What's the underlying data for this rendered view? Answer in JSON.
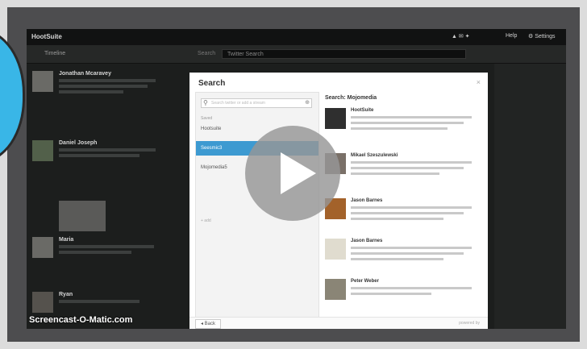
{
  "app": {
    "title": "HootSuite",
    "bar_items": [
      "▲ ✉ ✦",
      "Help",
      "⚙ Settings"
    ]
  },
  "tabs": {
    "timeline": "Timeline",
    "search_label": "Search",
    "search_placeholder": "Twitter Search"
  },
  "feed": [
    {
      "name": "Jonathan Mcaravey"
    },
    {
      "name": "Daniel Joseph"
    },
    {
      "name": "Maria"
    },
    {
      "name": "Ryan"
    }
  ],
  "dialog": {
    "title": "Search",
    "close": "×",
    "search_placeholder": "Search twitter or add a stream",
    "saved_heading": "Saved",
    "saved_items": [
      "Hootsuite",
      "Seesmic3",
      "Mojomedia5"
    ],
    "add_link": "+ add",
    "results_title": "Search: Mojomedia",
    "results": [
      {
        "name": "HootSuite"
      },
      {
        "name": "Mikael Szeszulewski"
      },
      {
        "name": "Jason Barnes"
      },
      {
        "name": "Jason Barnes"
      },
      {
        "name": "Peter Weber"
      }
    ],
    "back_label": "◂ Back",
    "footer_note": "powered by"
  },
  "watermark": "Screencast-O-Matic.com",
  "colors": {
    "accent": "#3d9ad1",
    "arc": "#39b6e7",
    "play": "#969696"
  }
}
